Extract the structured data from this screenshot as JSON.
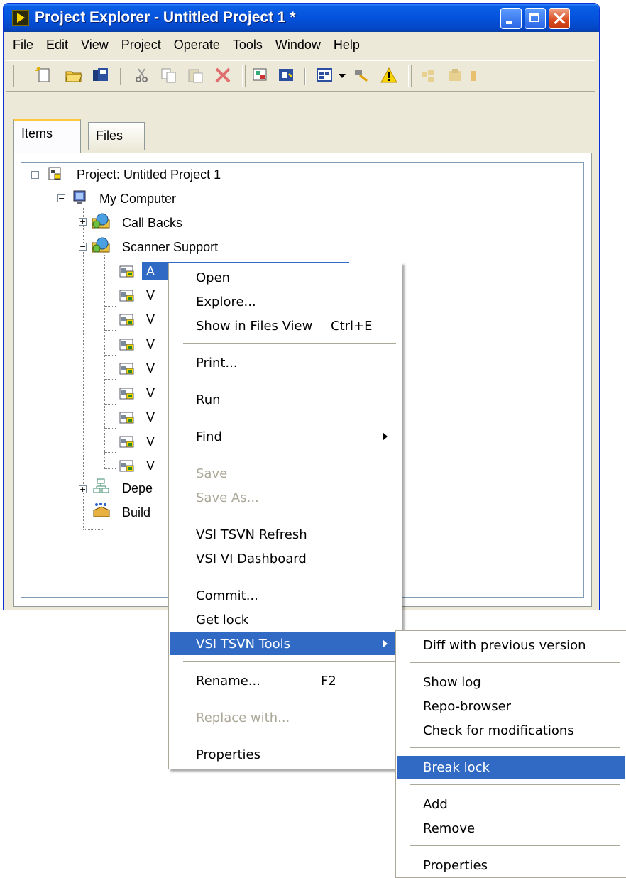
{
  "window": {
    "title": "Project Explorer - Untitled Project 1 *"
  },
  "menubar": [
    {
      "pre": "",
      "u": "F",
      "post": "ile"
    },
    {
      "pre": "",
      "u": "E",
      "post": "dit"
    },
    {
      "pre": "",
      "u": "V",
      "post": "iew"
    },
    {
      "pre": "",
      "u": "P",
      "post": "roject"
    },
    {
      "pre": "",
      "u": "O",
      "post": "perate"
    },
    {
      "pre": "",
      "u": "T",
      "post": "ools"
    },
    {
      "pre": "",
      "u": "W",
      "post": "indow"
    },
    {
      "pre": "",
      "u": "H",
      "post": "elp"
    }
  ],
  "tabs": [
    "Items",
    "Files"
  ],
  "tree": {
    "project": "Project: Untitled Project 1",
    "my_computer": "My Computer",
    "call_backs": "Call Backs",
    "scanner_support": "Scanner Support",
    "selected_item": "A",
    "vi_items": [
      "V",
      "V",
      "V",
      "V",
      "V",
      "V",
      "V",
      "V"
    ],
    "dependencies": "Depe",
    "build": "Build"
  },
  "context_menu": {
    "open": "Open",
    "explore": "Explore...",
    "show_in_files": "Show in Files View",
    "show_in_files_shortcut": "Ctrl+E",
    "print": "Print...",
    "run": "Run",
    "find": "Find",
    "save": "Save",
    "save_as": "Save As...",
    "tsvn_refresh": "VSI TSVN Refresh",
    "vi_dashboard": "VSI VI Dashboard",
    "commit": "Commit...",
    "get_lock": "Get lock",
    "tsvn_tools": "VSI TSVN Tools",
    "rename": "Rename...",
    "rename_shortcut": "F2",
    "replace_with": "Replace with...",
    "properties": "Properties"
  },
  "submenu": {
    "diff": "Diff with previous version",
    "show_log": "Show log",
    "repo_browser": "Repo-browser",
    "check_mods": "Check for modifications",
    "break_lock": "Break lock",
    "add": "Add",
    "remove": "Remove",
    "properties": "Properties"
  },
  "colors": {
    "selection": "#316ac5",
    "title_bar": "#0453dd",
    "window_bg": "#ece9d8"
  }
}
